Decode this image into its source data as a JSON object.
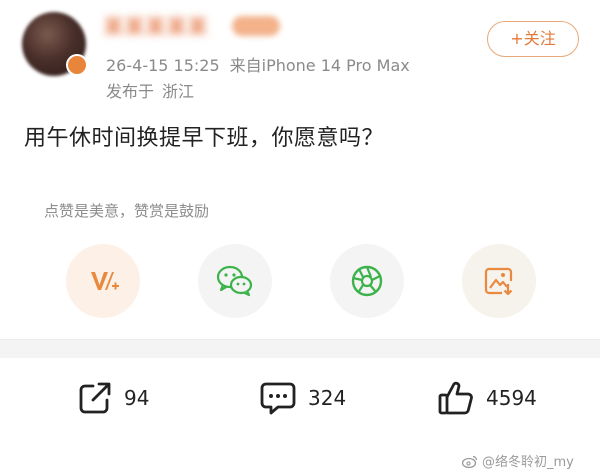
{
  "header": {
    "username": "某某某某某",
    "timestamp": "26-4-15 15:25",
    "source": "来自iPhone 14 Pro Max",
    "location_label": "发布于",
    "location": "浙江",
    "follow_label": "+关注"
  },
  "post": {
    "text": "用午休时间换提早下班，你愿意吗？"
  },
  "reward": {
    "hint": "点赞是美意，赞赏是鼓励",
    "buttons": [
      {
        "icon": "v-plus-icon",
        "color": "#e8893e"
      },
      {
        "icon": "wechat-icon",
        "color": "#3cb34a"
      },
      {
        "icon": "moments-icon",
        "color": "#3cb34a"
      },
      {
        "icon": "save-image-icon",
        "color": "#e8893e"
      }
    ]
  },
  "actions": {
    "repost_count": "94",
    "comment_count": "324",
    "like_count": "4594"
  },
  "watermark": {
    "text": "@络冬聆初_my"
  }
}
